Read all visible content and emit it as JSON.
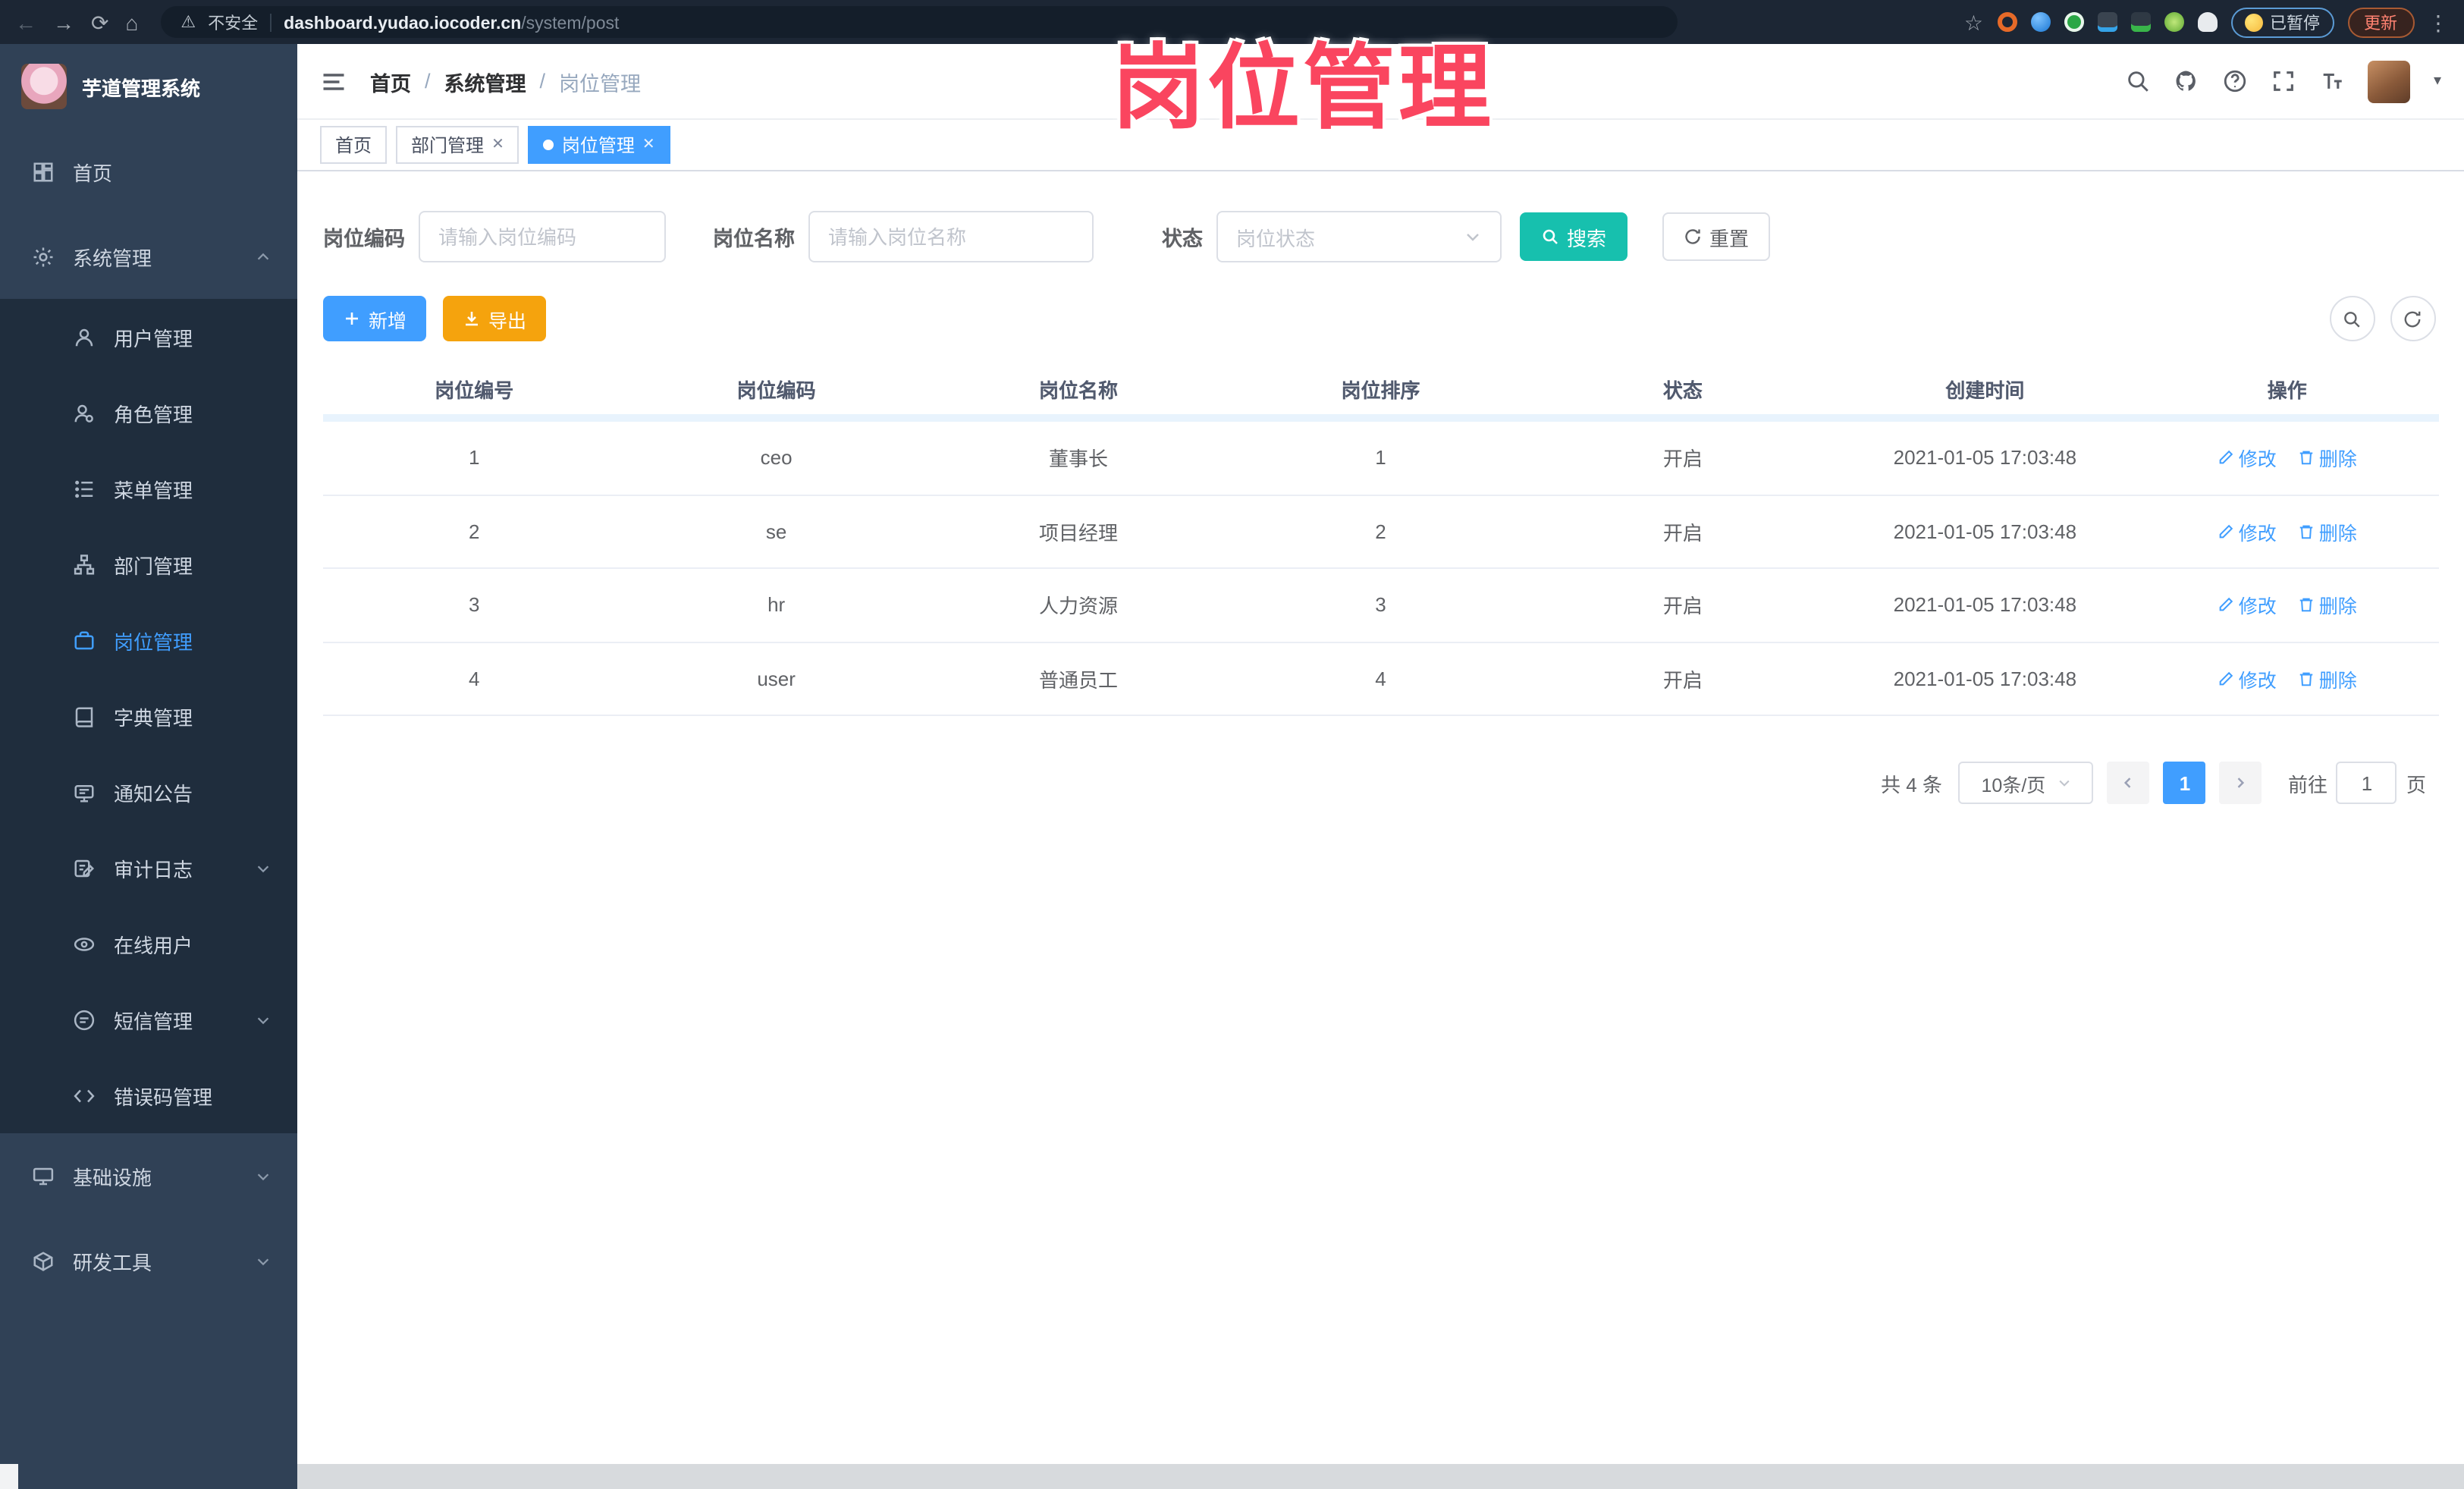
{
  "colors": {
    "accent": "#409eff",
    "search_button": "#17c0ae",
    "export_button": "#f5a30d",
    "overlay_text": "#fa455f",
    "sidebar_bg": "#304156",
    "submenu_bg": "#1f2d3d",
    "browser_bar_bg": "#1c2634"
  },
  "icons": {
    "back": "←",
    "forward": "→",
    "reload": "⟳",
    "home": "⌂",
    "warning": "⚠",
    "star": "☆",
    "kebab": "⋮",
    "caret_down": "▾"
  },
  "browser": {
    "security_label": "不安全",
    "url_host": "dashboard.yudao.iocoder.cn",
    "url_path": "/system/post",
    "paused_label": "已暂停",
    "update_label": "更新"
  },
  "overlay": {
    "title": "岗位管理"
  },
  "sidebar": {
    "app_title": "芋道管理系统",
    "items": [
      {
        "label": "首页"
      },
      {
        "label": "系统管理"
      },
      {
        "label": "用户管理"
      },
      {
        "label": "角色管理"
      },
      {
        "label": "菜单管理"
      },
      {
        "label": "部门管理"
      },
      {
        "label": "岗位管理"
      },
      {
        "label": "字典管理"
      },
      {
        "label": "通知公告"
      },
      {
        "label": "审计日志"
      },
      {
        "label": "在线用户"
      },
      {
        "label": "短信管理"
      },
      {
        "label": "错误码管理"
      },
      {
        "label": "基础设施"
      },
      {
        "label": "研发工具"
      }
    ]
  },
  "header": {
    "breadcrumb": [
      "首页",
      "系统管理",
      "岗位管理"
    ]
  },
  "tabs": [
    {
      "label": "首页"
    },
    {
      "label": "部门管理"
    },
    {
      "label": "岗位管理"
    }
  ],
  "filters": {
    "code_label": "岗位编码",
    "code_placeholder": "请输入岗位编码",
    "name_label": "岗位名称",
    "name_placeholder": "请输入岗位名称",
    "status_label": "状态",
    "status_placeholder": "岗位状态",
    "search_label": "搜索",
    "reset_label": "重置"
  },
  "toolbar": {
    "add_label": "新增",
    "export_label": "导出"
  },
  "table": {
    "headers": [
      "岗位编号",
      "岗位编码",
      "岗位名称",
      "岗位排序",
      "状态",
      "创建时间",
      "操作"
    ],
    "edit_label": "修改",
    "delete_label": "删除",
    "rows": [
      {
        "id": "1",
        "code": "ceo",
        "name": "董事长",
        "sort": "1",
        "status": "开启",
        "created_at": "2021-01-05 17:03:48"
      },
      {
        "id": "2",
        "code": "se",
        "name": "项目经理",
        "sort": "2",
        "status": "开启",
        "created_at": "2021-01-05 17:03:48"
      },
      {
        "id": "3",
        "code": "hr",
        "name": "人力资源",
        "sort": "3",
        "status": "开启",
        "created_at": "2021-01-05 17:03:48"
      },
      {
        "id": "4",
        "code": "user",
        "name": "普通员工",
        "sort": "4",
        "status": "开启",
        "created_at": "2021-01-05 17:03:48"
      }
    ]
  },
  "pagination": {
    "total_text": "共 4 条",
    "page_size": "10条/页",
    "current_page": "1",
    "goto_label": "前往",
    "goto_value": "1",
    "page_suffix": "页"
  }
}
